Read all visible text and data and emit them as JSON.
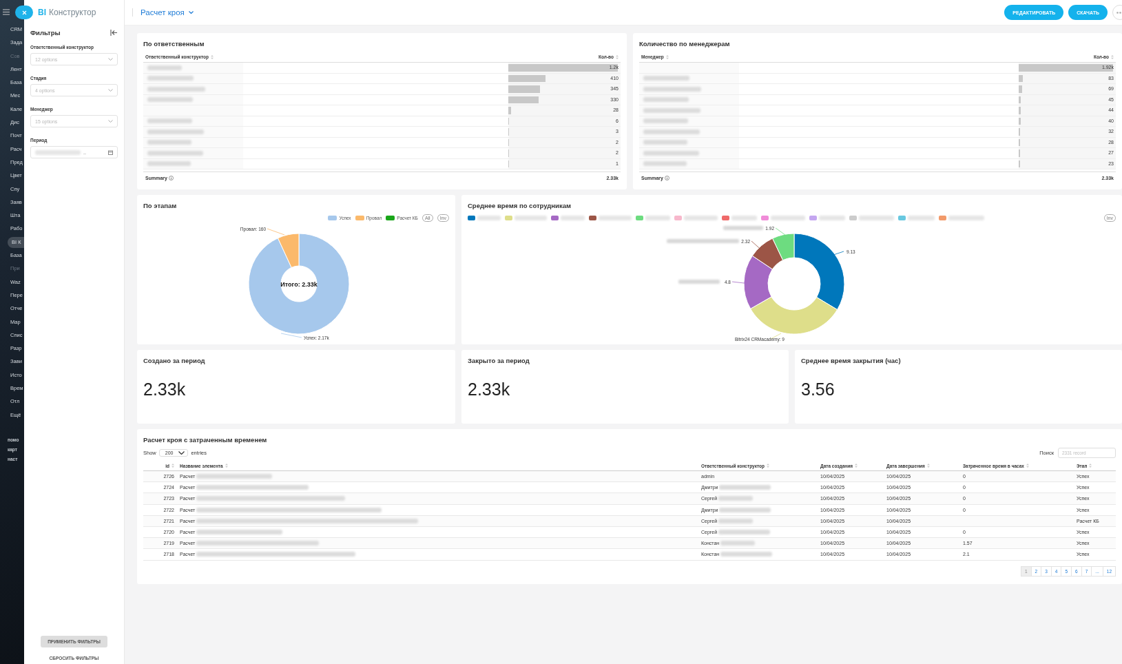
{
  "sidebar": {
    "items": [
      {
        "label": "CRM",
        "selected": false,
        "dimmed": false
      },
      {
        "label": "Зада",
        "selected": false,
        "dimmed": false
      },
      {
        "label": "Сов",
        "selected": false,
        "dimmed": true
      },
      {
        "label": "Лент",
        "selected": false,
        "dimmed": false
      },
      {
        "label": "База",
        "selected": false,
        "dimmed": false
      },
      {
        "label": "Мес",
        "selected": false,
        "dimmed": false
      },
      {
        "label": "Кале",
        "selected": false,
        "dimmed": false
      },
      {
        "label": "Дис",
        "selected": false,
        "dimmed": false
      },
      {
        "label": "Почт",
        "selected": false,
        "dimmed": false
      },
      {
        "label": "Расч",
        "selected": false,
        "dimmed": false
      },
      {
        "label": "Пред",
        "selected": false,
        "dimmed": false
      },
      {
        "label": "Цвет",
        "selected": false,
        "dimmed": false
      },
      {
        "label": "Спу",
        "selected": false,
        "dimmed": false
      },
      {
        "label": "Заяв",
        "selected": false,
        "dimmed": false
      },
      {
        "label": "Шта",
        "selected": false,
        "dimmed": false
      },
      {
        "label": "Рабо",
        "selected": false,
        "dimmed": false
      },
      {
        "label": "BI К",
        "selected": true,
        "dimmed": false
      },
      {
        "label": "База",
        "selected": false,
        "dimmed": false
      },
      {
        "label": "При",
        "selected": false,
        "dimmed": true
      },
      {
        "label": "Waz",
        "selected": false,
        "dimmed": false
      },
      {
        "label": "Пере",
        "selected": false,
        "dimmed": false
      },
      {
        "label": "Отче",
        "selected": false,
        "dimmed": false
      },
      {
        "label": "Мар",
        "selected": false,
        "dimmed": false
      },
      {
        "label": "Спис",
        "selected": false,
        "dimmed": false
      },
      {
        "label": "Разр",
        "selected": false,
        "dimmed": false
      },
      {
        "label": "Зави",
        "selected": false,
        "dimmed": false
      },
      {
        "label": "Исто",
        "selected": false,
        "dimmed": false
      },
      {
        "label": "Врем",
        "selected": false,
        "dimmed": false
      },
      {
        "label": "Отл",
        "selected": false,
        "dimmed": false
      },
      {
        "label": "Ещё",
        "selected": false,
        "dimmed": false
      }
    ],
    "footer_links": [
      "помо",
      "карт",
      "наст"
    ]
  },
  "header": {
    "logo_mark": "BI",
    "logo_text": "Конструктор",
    "report_title": "Расчет кроя",
    "buttons": [
      "РЕДАКТИРОВАТЬ",
      "СКАЧАТЬ"
    ]
  },
  "filters": {
    "title": "Фильтры",
    "fields": [
      {
        "kind": "select",
        "label": "Ответственный конструктор",
        "placeholder": "12 options"
      },
      {
        "kind": "select",
        "label": "Стадия",
        "placeholder": "4 options"
      },
      {
        "kind": "select",
        "label": "Менеджер",
        "placeholder": "15 options"
      },
      {
        "kind": "date",
        "label": "Период",
        "value": ".."
      }
    ],
    "apply": {
      "label": "ПРИМЕНИТЬ ФИЛЬТРЫ",
      "disabled": true
    },
    "reset": "СБРОСИТЬ ФИЛЬТРЫ"
  },
  "bar_tables": [
    {
      "title": "По ответственным",
      "columns": [
        "Ответственный конструктор",
        "Кол-во"
      ],
      "rows": [
        {
          "redacted": true,
          "count": "1.2k",
          "level": 1
        },
        {
          "redacted": true,
          "count": "410",
          "level": 0.342
        },
        {
          "redacted": true,
          "count": "345",
          "level": 0.288
        },
        {
          "redacted": true,
          "count": "330",
          "level": 0.275
        },
        {
          "redacted": false,
          "count": "28",
          "level": 0.023
        },
        {
          "redacted": true,
          "count": "6",
          "level": 0.005
        },
        {
          "redacted": true,
          "count": "3",
          "level": 0.0025
        },
        {
          "redacted": true,
          "count": "2",
          "level": 0.0017
        },
        {
          "redacted": true,
          "count": "2",
          "level": 0.0017
        },
        {
          "redacted": true,
          "count": "1",
          "level": 0.0008
        }
      ],
      "summary_label": "Summary",
      "summary_value": "2.33k"
    },
    {
      "title": "Количество по менеджерам",
      "columns": [
        "Менеджер",
        "Кол-во"
      ],
      "rows": [
        {
          "redacted": false,
          "count": "1.92k",
          "level": 1
        },
        {
          "redacted": true,
          "count": "83",
          "level": 0.043
        },
        {
          "redacted": true,
          "count": "69",
          "level": 0.036
        },
        {
          "redacted": true,
          "count": "45",
          "level": 0.023
        },
        {
          "redacted": true,
          "count": "44",
          "level": 0.023
        },
        {
          "redacted": true,
          "count": "40",
          "level": 0.021
        },
        {
          "redacted": true,
          "count": "32",
          "level": 0.017
        },
        {
          "redacted": true,
          "count": "28",
          "level": 0.015
        },
        {
          "redacted": true,
          "count": "27",
          "level": 0.014
        },
        {
          "redacted": true,
          "count": "23",
          "level": 0.012
        }
      ],
      "summary_label": "Summary",
      "summary_value": "2.33k"
    }
  ],
  "charts": [
    {
      "title": "По этапам",
      "legend_buttons": [
        "All",
        "Inv"
      ],
      "center_label": "Итого: 2.33k",
      "chart_data": {
        "type": "donut",
        "categories": [
          "Успех",
          "Провал",
          "Расчет КБ"
        ],
        "values": [
          2170,
          160,
          null
        ],
        "colors": [
          "#a6c8ec",
          "#fbb96b",
          "#1aa61a"
        ],
        "value_labels": [
          "Успех: 2.17k",
          "Провал: 160",
          null
        ]
      }
    },
    {
      "title": "Среднее время по сотрудникам",
      "legend": [
        {
          "color": "#0077bb"
        },
        {
          "color": "#dede8a"
        },
        {
          "color": "#a569c4"
        },
        {
          "color": "#9c5546"
        },
        {
          "color": "#6ddc80"
        },
        {
          "color": "#f7b8cc"
        },
        {
          "color": "#ef6a6a"
        },
        {
          "color": "#f08cd8"
        },
        {
          "color": "#c4a6f0"
        },
        {
          "color": "#cccccc"
        },
        {
          "color": "#68c8e0"
        },
        {
          "color": "#f29a6a"
        }
      ],
      "legend_buttons": [
        "Inv"
      ],
      "chart_data": {
        "type": "donut",
        "values": [
          9.13,
          9,
          4.8,
          2.32,
          1.92
        ],
        "colors": [
          "#0077bb",
          "#dede8a",
          "#a569c4",
          "#9c5546",
          "#6ddc80"
        ],
        "value_labels": [
          "9.13",
          "Bitrix24 CRMacademy: 9",
          "4.8",
          "2.32",
          "1.92"
        ]
      }
    }
  ],
  "kpis": [
    {
      "title": "Создано за период",
      "value": "2.33k"
    },
    {
      "title": "Закрыто за период",
      "value": "2.33k"
    },
    {
      "title": "Среднее время закрытия (час)",
      "value": "3.56"
    }
  ],
  "records": {
    "title": "Расчет кроя с затраченным временем",
    "show_label": "Show",
    "page_size": "200",
    "entries_label": "entries",
    "search_label": "Поиск",
    "search_placeholder": "2331 record",
    "columns": [
      "id",
      "Название элемента",
      "Ответственный конструктор",
      "Дата создания",
      "Дата завершения",
      "Затраченное время в часах",
      "Этап"
    ],
    "rows": [
      {
        "id": "2726",
        "name": "Расчет",
        "constructor": "admin",
        "created": "10/04/2025",
        "finished": "10/04/2025",
        "hours": "0",
        "stage": "Успех"
      },
      {
        "id": "2724",
        "name": "Расчет",
        "constructor": "Дмитри",
        "created": "10/04/2025",
        "finished": "10/04/2025",
        "hours": "0",
        "stage": "Успех"
      },
      {
        "id": "2723",
        "name": "Расчет",
        "constructor": "Сергей",
        "created": "10/04/2025",
        "finished": "10/04/2025",
        "hours": "0",
        "stage": "Успех"
      },
      {
        "id": "2722",
        "name": "Расчет",
        "constructor": "Дмитри",
        "created": "10/04/2025",
        "finished": "10/04/2025",
        "hours": "0",
        "stage": "Успех"
      },
      {
        "id": "2721",
        "name": "Расчет",
        "constructor": "Сергей",
        "created": "10/04/2025",
        "finished": "10/04/2025",
        "stage": "Расчет КБ"
      },
      {
        "id": "2720",
        "name": "Расчет",
        "constructor": "Сергей",
        "created": "10/04/2025",
        "finished": "10/04/2025",
        "hours": "0",
        "stage": "Успех"
      },
      {
        "id": "2719",
        "name": "Расчет",
        "constructor": "Констан",
        "created": "10/04/2025",
        "finished": "10/04/2025",
        "hours": "1.57",
        "stage": "Успех"
      },
      {
        "id": "2718",
        "name": "Расчет",
        "constructor": "Констан",
        "created": "10/04/2025",
        "finished": "10/04/2025",
        "hours": "2.1",
        "stage": "Успех"
      }
    ],
    "pages": [
      {
        "label": "1",
        "selected": true
      },
      {
        "label": "2",
        "selected": false
      },
      {
        "label": "3",
        "selected": false
      },
      {
        "label": "4",
        "selected": false
      },
      {
        "label": "5",
        "selected": false
      },
      {
        "label": "6",
        "selected": false
      },
      {
        "label": "7",
        "selected": false
      },
      {
        "label": "...",
        "selected": false
      },
      {
        "label": "12",
        "selected": false
      }
    ]
  }
}
